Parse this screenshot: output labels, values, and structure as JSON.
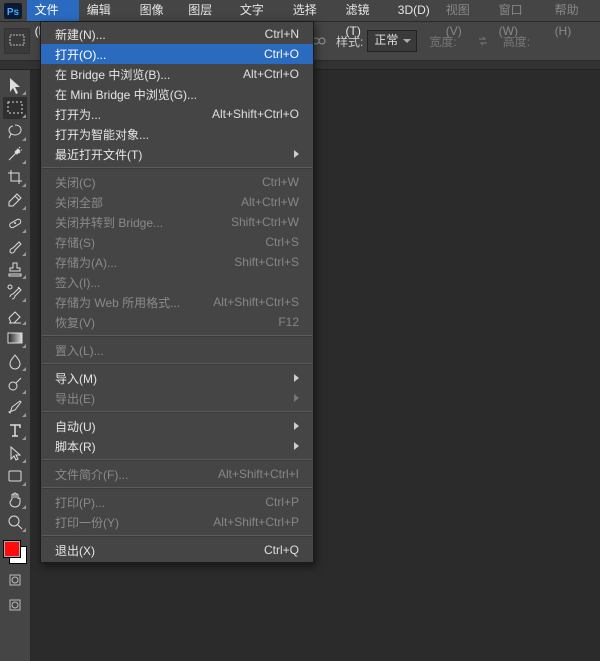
{
  "menubar": {
    "items": [
      {
        "label": "文件(F)",
        "active": true
      },
      {
        "label": "编辑(E)"
      },
      {
        "label": "图像(I)"
      },
      {
        "label": "图层(L)"
      },
      {
        "label": "文字(Y)"
      },
      {
        "label": "选择(S)"
      },
      {
        "label": "滤镜(T)"
      },
      {
        "label": "3D(D)"
      },
      {
        "label": "视图(V)"
      },
      {
        "label": "窗口(W)"
      },
      {
        "label": "帮助(H)"
      }
    ]
  },
  "options": {
    "style_label": "样式:",
    "style_value": "正常",
    "width_label": "宽度:",
    "height_label": "高度:"
  },
  "file_menu": {
    "items": [
      {
        "label": "新建(N)...",
        "shortcut": "Ctrl+N"
      },
      {
        "label": "打开(O)...",
        "shortcut": "Ctrl+O",
        "hl": true
      },
      {
        "label": "在 Bridge 中浏览(B)...",
        "shortcut": "Alt+Ctrl+O"
      },
      {
        "label": "在 Mini Bridge 中浏览(G)..."
      },
      {
        "label": "打开为...",
        "shortcut": "Alt+Shift+Ctrl+O"
      },
      {
        "label": "打开为智能对象..."
      },
      {
        "label": "最近打开文件(T)",
        "sub": true
      },
      {
        "sep": true
      },
      {
        "label": "关闭(C)",
        "shortcut": "Ctrl+W",
        "disabled": true
      },
      {
        "label": "关闭全部",
        "shortcut": "Alt+Ctrl+W",
        "disabled": true
      },
      {
        "label": "关闭并转到 Bridge...",
        "shortcut": "Shift+Ctrl+W",
        "disabled": true
      },
      {
        "label": "存储(S)",
        "shortcut": "Ctrl+S",
        "disabled": true
      },
      {
        "label": "存储为(A)...",
        "shortcut": "Shift+Ctrl+S",
        "disabled": true
      },
      {
        "label": "签入(I)...",
        "disabled": true
      },
      {
        "label": "存储为 Web 所用格式...",
        "shortcut": "Alt+Shift+Ctrl+S",
        "disabled": true
      },
      {
        "label": "恢复(V)",
        "shortcut": "F12",
        "disabled": true
      },
      {
        "sep": true
      },
      {
        "label": "置入(L)...",
        "disabled": true
      },
      {
        "sep": true
      },
      {
        "label": "导入(M)",
        "sub": true
      },
      {
        "label": "导出(E)",
        "sub": true,
        "disabled": true
      },
      {
        "sep": true
      },
      {
        "label": "自动(U)",
        "sub": true
      },
      {
        "label": "脚本(R)",
        "sub": true
      },
      {
        "sep": true
      },
      {
        "label": "文件简介(F)...",
        "shortcut": "Alt+Shift+Ctrl+I",
        "disabled": true
      },
      {
        "sep": true
      },
      {
        "label": "打印(P)...",
        "shortcut": "Ctrl+P",
        "disabled": true
      },
      {
        "label": "打印一份(Y)",
        "shortcut": "Alt+Shift+Ctrl+P",
        "disabled": true
      },
      {
        "sep": true
      },
      {
        "label": "退出(X)",
        "shortcut": "Ctrl+Q"
      }
    ]
  },
  "tools": [
    {
      "name": "move-tool",
      "svg": "move"
    },
    {
      "name": "marquee-tool",
      "svg": "marquee",
      "sel": true
    },
    {
      "name": "lasso-tool",
      "svg": "lasso"
    },
    {
      "name": "quick-select-tool",
      "svg": "wand"
    },
    {
      "name": "crop-tool",
      "svg": "crop"
    },
    {
      "name": "eyedropper-tool",
      "svg": "eyedrop"
    },
    {
      "name": "healing-tool",
      "svg": "bandage"
    },
    {
      "name": "brush-tool",
      "svg": "brush"
    },
    {
      "name": "stamp-tool",
      "svg": "stamp"
    },
    {
      "name": "history-brush-tool",
      "svg": "hbrush"
    },
    {
      "name": "eraser-tool",
      "svg": "eraser"
    },
    {
      "name": "gradient-tool",
      "svg": "gradient"
    },
    {
      "name": "blur-tool",
      "svg": "blur"
    },
    {
      "name": "dodge-tool",
      "svg": "dodge"
    },
    {
      "name": "pen-tool",
      "svg": "pen"
    },
    {
      "name": "type-tool",
      "svg": "type"
    },
    {
      "name": "path-select-tool",
      "svg": "pathsel"
    },
    {
      "name": "shape-tool",
      "svg": "shape"
    },
    {
      "name": "hand-tool",
      "svg": "hand"
    },
    {
      "name": "zoom-tool",
      "svg": "zoom"
    }
  ]
}
